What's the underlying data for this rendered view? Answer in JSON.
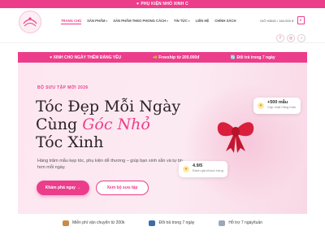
{
  "topbar": {
    "text": "PHỤ KIỆN NHỎ XINH C"
  },
  "nav": [
    {
      "label": "TRANG CHỦ",
      "active": true,
      "dropdown": false
    },
    {
      "label": "SẢN PHẨM",
      "active": false,
      "dropdown": true
    },
    {
      "label": "SẢN PHẨM THEO PHONG CÁCH",
      "active": false,
      "dropdown": true
    },
    {
      "label": "TIN TỨC",
      "active": false,
      "dropdown": true
    },
    {
      "label": "LIÊN HỆ",
      "active": false,
      "dropdown": false
    },
    {
      "label": "CHÍNH SÁCH",
      "active": false,
      "dropdown": false
    }
  ],
  "account": {
    "label": "GIỎ HÀNG / 184.000 đ"
  },
  "cart": {
    "count": "0"
  },
  "social": [
    "f",
    "◎",
    "♪"
  ],
  "promo": [
    {
      "icon": "heart-icon",
      "text": "♥ XINH CHO NGÀY THÊM ĐÁNG YÊU"
    },
    {
      "icon": "truck-icon",
      "text": "Freeship từ 200.000đ"
    },
    {
      "icon": "refresh-icon",
      "text": "Đổi trả trong 7 ngày"
    }
  ],
  "hero": {
    "eyebrow": "BỘ SƯU TẬP MỚI 2026",
    "line1": "Tóc Đẹp Mỗi Ngày",
    "line2_prefix": "Cùng ",
    "line2_accent": "Góc Nhỏ",
    "line3": "Tóc Xinh",
    "description": "Hàng trăm mẫu kẹp tóc, phụ kiện dễ thương – giúp bạn xinh xắn và tự tin hơn mỗi ngày.",
    "primary_button": "Khám phá ngay →",
    "secondary_button": "Xem bộ sưu tập",
    "card1_value": "+500 mẫu",
    "card1_text": "Cập nhật hằng tuần",
    "card2_value": "4.9/5",
    "card2_text": "Đánh giá khách hàng"
  },
  "benefits": [
    {
      "icon": "truck-icon",
      "text": "Miễn phí vận chuyển từ 200k",
      "color": "#c98b4a"
    },
    {
      "icon": "refresh-icon",
      "text": "Đổi trả trong 7 ngày",
      "color": "#3a6ea8"
    },
    {
      "icon": "support-icon",
      "text": "Hỗ trợ 7 ngày/tuần",
      "color": "#9aa8b8"
    }
  ],
  "colors": {
    "accent": "#ec3d8b",
    "hero_bg": "#fde6ef"
  }
}
